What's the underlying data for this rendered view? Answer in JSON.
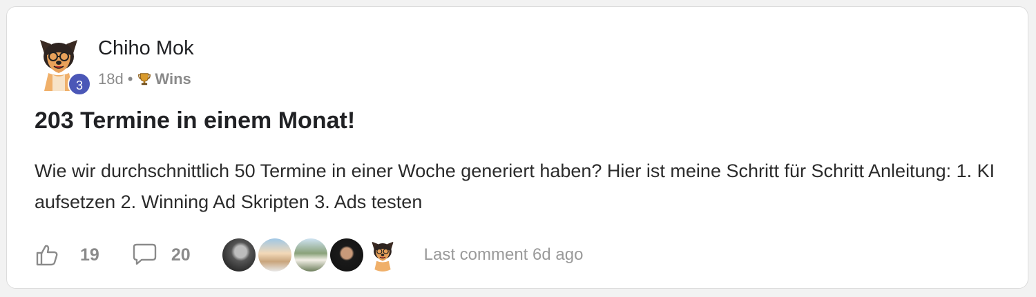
{
  "author": {
    "name": "Chiho Mok",
    "level": "3"
  },
  "meta": {
    "time": "18d",
    "separator": "•",
    "category": "Wins",
    "category_icon": "trophy-icon"
  },
  "post": {
    "title": "203 Termine in einem Monat!",
    "body": "Wie wir durchschnittlich 50 Termine in einer Woche generiert haben? Hier ist meine Schritt für Schritt Anleitung: 1. KI aufsetzen 2. Winning Ad Skripten 3. Ads testen"
  },
  "footer": {
    "likes": "19",
    "like_icon": "thumbs-up-icon",
    "comments": "20",
    "comment_icon": "speech-bubble-icon",
    "last_comment": "Last comment 6d ago"
  },
  "colors": {
    "level_badge": "#4b57b7",
    "muted_text": "#8a8a8a",
    "title_text": "#202124"
  }
}
